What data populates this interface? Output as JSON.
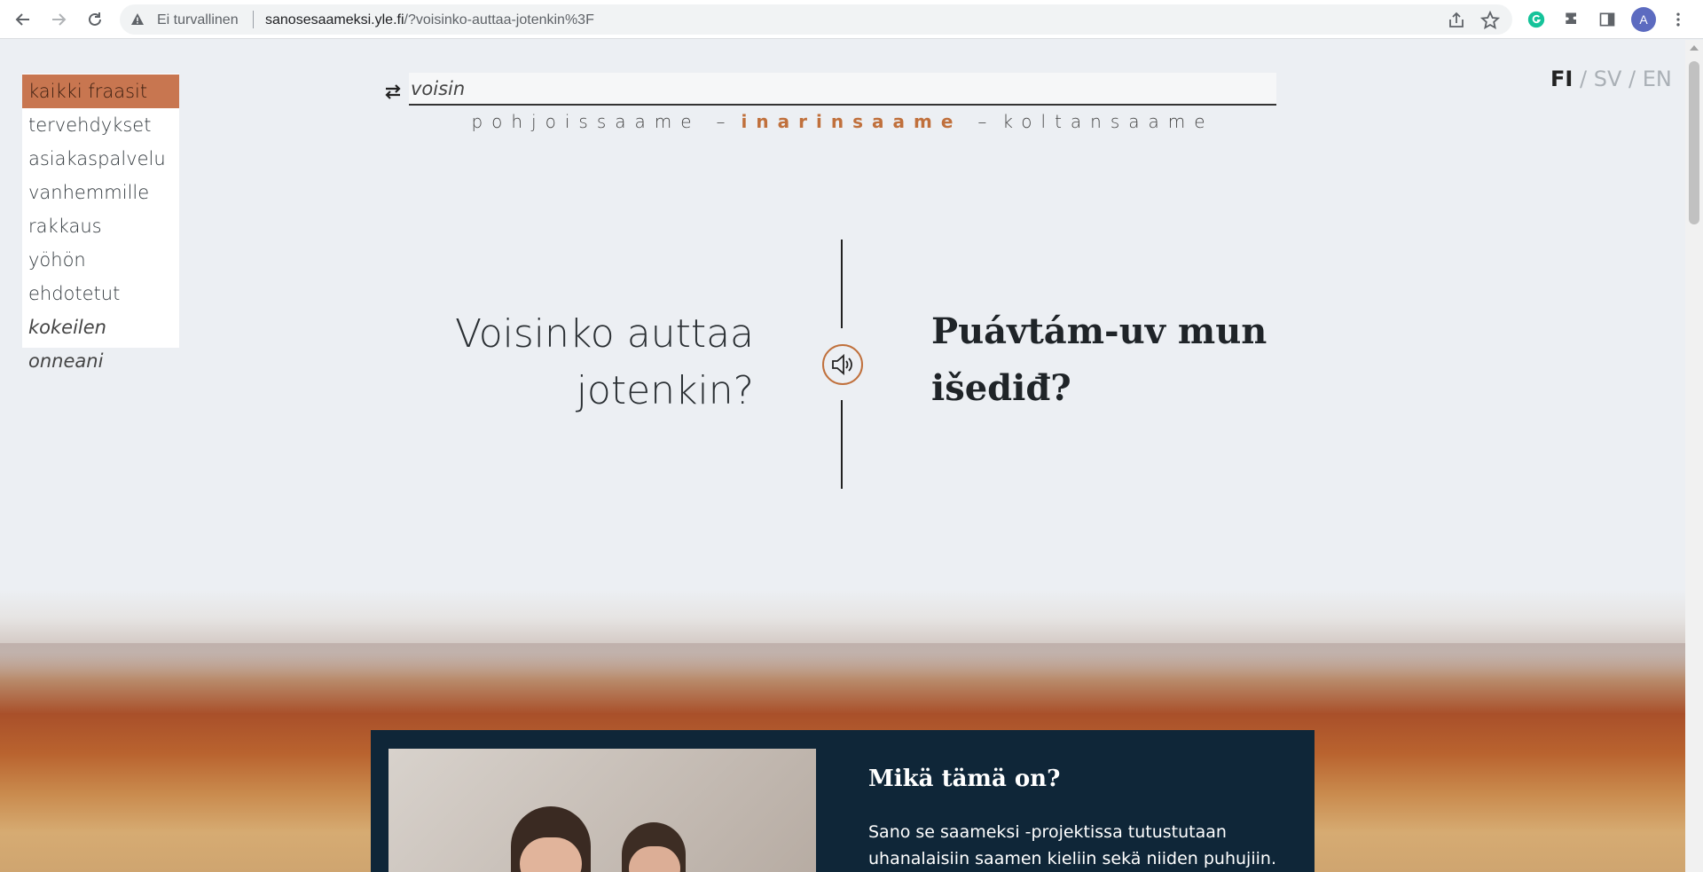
{
  "browser": {
    "security_label": "Ei turvallinen",
    "url_host": "sanosesaameksi.yle.fi",
    "url_path": "/?voisinko-auttaa-jotenkin%3F",
    "avatar_initial": "A"
  },
  "sidebar": {
    "items": [
      {
        "label": "kaikki fraasit",
        "active": true
      },
      {
        "label": "tervehdykset"
      },
      {
        "label": "asiakaspalvelu"
      },
      {
        "label": "vanhemmille"
      },
      {
        "label": "rakkaus"
      },
      {
        "label": "yöhön"
      },
      {
        "label": "ehdotetut"
      },
      {
        "label": "kokeilen onneani"
      }
    ]
  },
  "search": {
    "value": "voisin"
  },
  "language_selector": {
    "options": [
      "pohjoissaame",
      "inarinsaame",
      "koltansaame"
    ],
    "separator": "–",
    "selected": "inarinsaame"
  },
  "ui_language": {
    "current": "FI",
    "others": [
      "SV",
      "EN"
    ],
    "separator": "/"
  },
  "phrase": {
    "finnish_line1": "Voisinko auttaa",
    "finnish_line2": "jotenkin?",
    "sami_line1": "Puávtám-uv mun",
    "sami_line2": "išediđ?"
  },
  "info": {
    "title": "Mikä tämä on?",
    "text": "Sano se saameksi -projektissa tutustutaan uhanalaisiin saamen kieliin sekä niiden puhujiin. Sivun"
  },
  "colors": {
    "accent": "#c0703c",
    "active_item": "#c87650",
    "info_bg": "#0f2638",
    "page_bg": "#eceff3"
  }
}
